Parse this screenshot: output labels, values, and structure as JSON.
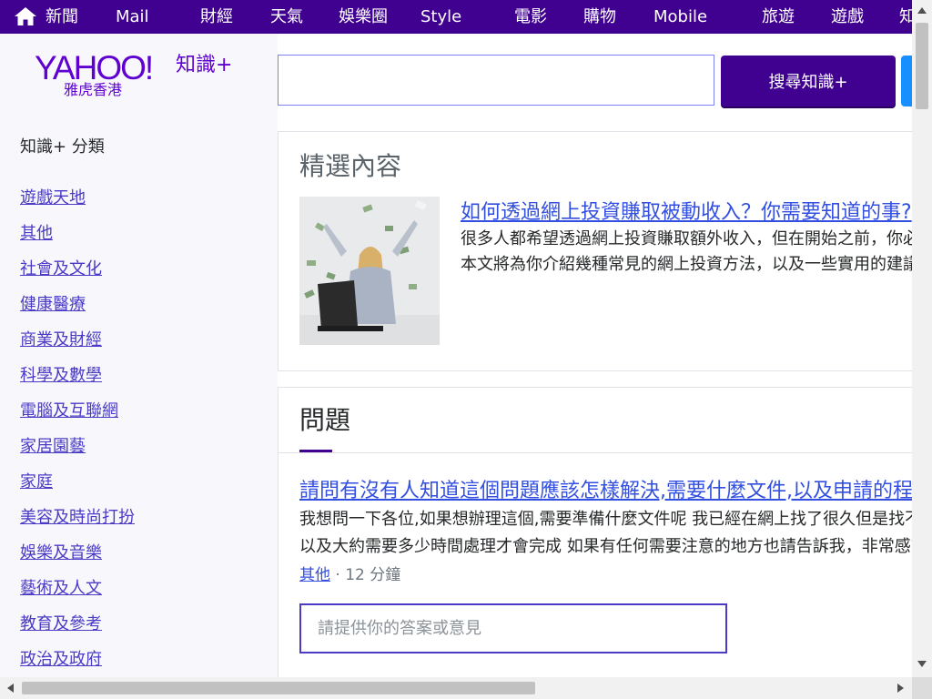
{
  "topnav": {
    "home_icon": "home-icon",
    "items": [
      "新聞",
      "Mail",
      "財經",
      "天氣",
      "娛樂圈",
      "Style",
      "電影",
      "購物",
      "Mobile",
      "旅遊",
      "遊戲",
      "知"
    ]
  },
  "logo": {
    "wordmark": "YAHOO!",
    "subtitle": "雅虎香港",
    "product": "知識+"
  },
  "search": {
    "value": "",
    "placeholder": "",
    "button_label": "搜尋知識+"
  },
  "sidebar": {
    "title": "知識+ 分類",
    "categories": [
      "遊戲天地",
      "其他",
      "社會及文化",
      "健康醫療",
      "商業及財經",
      "科學及數學",
      "電腦及互聯網",
      "家居園藝",
      "家庭",
      "美容及時尚打扮",
      "娛樂及音樂",
      "藝術及人文",
      "教育及參考",
      "政治及政府"
    ]
  },
  "featured": {
    "heading": "精選內容",
    "image_icon": "thumbnail-image",
    "title": "如何透過網上投資賺取被動收入？你需要知道的事?",
    "desc_lines": [
      "很多人都希望透過網上投資賺取額外收入，但在開始之前，你必須先了解相關的風險和回報。",
      "本文將為你介紹幾種常見的網上投資方法，以及一些實用的建議，幫助你作出明智的決定。 閱讀更多"
    ]
  },
  "questions": {
    "tab_label": "問題",
    "item": {
      "title": "請問有沒有人知道這個問題應該怎樣解決,需要什麼文件,以及申請的程序是怎樣的呢？謝謝各位的幫忙",
      "body_lines": [
        "我想問一下各位,如果想辦理這個,需要準備什麼文件呢 我已經在網上找了很久但是找不到 希望有經驗的人可以分享一下他們的經驗",
        "以及大約需要多少時間處理才會完成 如果有任何需要注意的地方也請告訴我，非常感謝大家的幫忙 謝謝各位！"
      ],
      "category": "其他",
      "separator": "·",
      "age": "12 分鐘"
    },
    "answer_placeholder": "請提供你的答案或意見"
  },
  "colors": {
    "nav_bg": "#400090",
    "brand_purple": "#5f01d1",
    "link_blue": "#324fe1"
  }
}
